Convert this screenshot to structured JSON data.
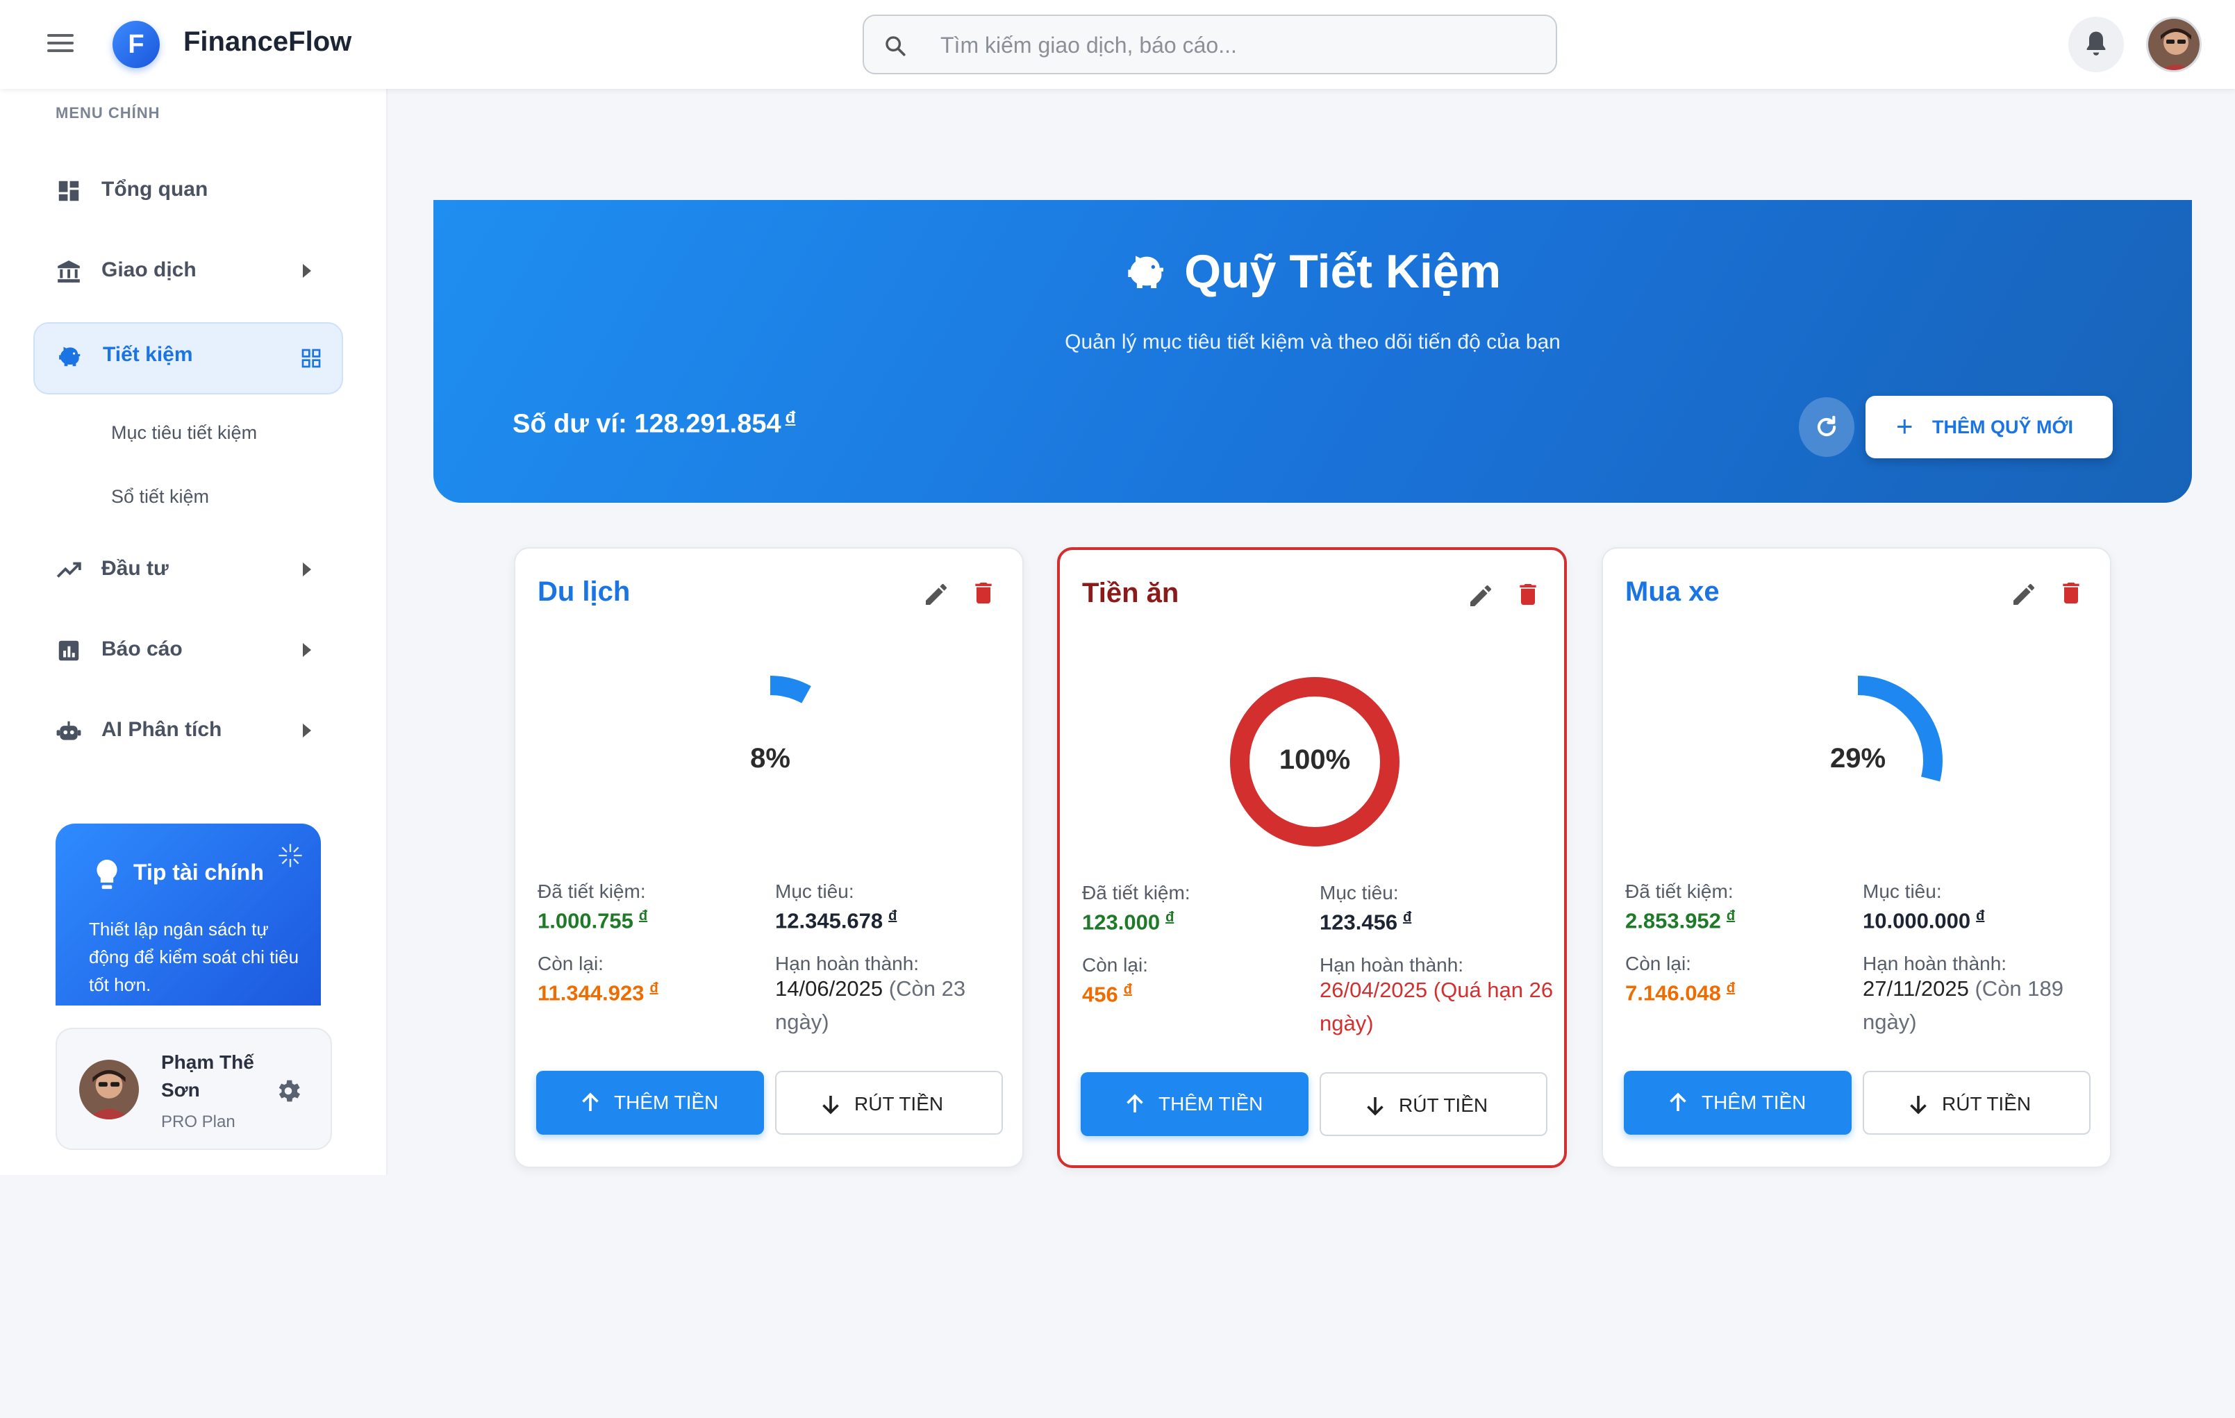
{
  "app": {
    "logo_letter": "F",
    "title": "FinanceFlow"
  },
  "search": {
    "placeholder": "Tìm kiếm giao dịch, báo cáo..."
  },
  "sidebar": {
    "heading": "MENU CHÍNH",
    "items": [
      {
        "label": "Tổng quan",
        "icon": "dashboard-icon"
      },
      {
        "label": "Giao dịch",
        "icon": "bank-icon"
      },
      {
        "label": "Tiết kiệm",
        "icon": "piggy-bank-icon",
        "active": true
      },
      {
        "label": "Đầu tư",
        "icon": "trending-up-icon"
      },
      {
        "label": "Báo cáo",
        "icon": "report-icon"
      },
      {
        "label": "AI Phân tích",
        "icon": "robot-icon"
      }
    ],
    "sub_items": [
      "Mục tiêu tiết kiệm",
      "Sổ tiết kiệm"
    ],
    "tip": {
      "title": "Tip tài chính",
      "text": "Thiết lập ngân sách tự động để kiểm soát chi tiêu tốt hơn."
    },
    "user": {
      "name": "Phạm Thế Sơn",
      "plan": "PRO Plan"
    }
  },
  "hero": {
    "title": "Quỹ Tiết Kiệm",
    "subtitle": "Quản lý mục tiêu tiết kiệm và theo dõi tiến độ của bạn",
    "balance_label": "Số dư ví: 128.291.854",
    "currency": "đ",
    "add_button": "THÊM QUỸ MỚI"
  },
  "labels": {
    "saved": "Đã tiết kiệm:",
    "target": "Mục tiêu:",
    "remaining": "Còn lại:",
    "deadline": "Hạn hoàn thành:",
    "add_money": "THÊM TIỀN",
    "withdraw": "RÚT TIỀN"
  },
  "funds": [
    {
      "name": "Du lịch",
      "percent": 8,
      "percent_text": "8%",
      "saved": "1.000.755",
      "target": "12.345.678",
      "remaining": "11.344.923",
      "deadline": "14/06/2025",
      "deadline_note": "(Còn 23 ngày)",
      "overdue": false
    },
    {
      "name": "Tiền ăn",
      "percent": 100,
      "percent_text": "100%",
      "saved": "123.000",
      "target": "123.456",
      "remaining": "456",
      "deadline": "26/04/2025",
      "deadline_note": "(Quá hạn 26 ngày)",
      "overdue": true
    },
    {
      "name": "Mua xe",
      "percent": 29,
      "percent_text": "29%",
      "saved": "2.853.952",
      "target": "10.000.000",
      "remaining": "7.146.048",
      "deadline": "27/11/2025",
      "deadline_note": "(Còn 189 ngày)",
      "overdue": false
    }
  ],
  "colors": {
    "primary": "#1e88f0",
    "danger": "#d32f2f",
    "saved": "#1f7a28",
    "remaining": "#ef6c00"
  }
}
